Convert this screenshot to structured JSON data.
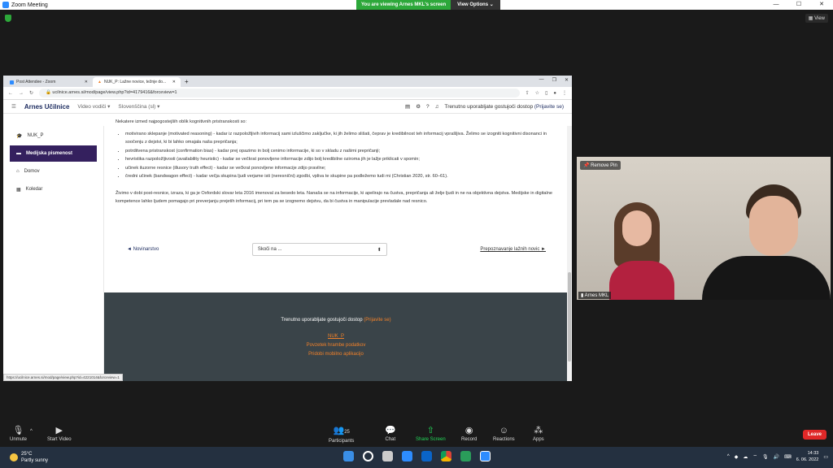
{
  "zoom": {
    "window_title": "Zoom Meeting",
    "banner": "You are viewing Arnes MKL's screen",
    "view_options": "View Options",
    "view_button": "View",
    "remove_pin": "Remove Pin",
    "participant_name": "Arnes MKL",
    "controls": {
      "unmute": "Unmute",
      "start_video": "Start Video",
      "participants": "Participants",
      "participants_count": "25",
      "chat": "Chat",
      "share_screen": "Share Screen",
      "record": "Record",
      "reactions": "Reactions",
      "apps": "Apps",
      "leave": "Leave"
    }
  },
  "browser": {
    "tabs": [
      {
        "label": "Post Attendee - Zoom"
      },
      {
        "label": "NUK_P: Lažne novice, težnje do..."
      }
    ],
    "url": "ucilnice.arnes.si/mod/page/view.php?id=4179416&forceview=1",
    "status_url": "https://ucilnice.arnes.si/mod/page/view.php?id=4221014&forceview=1"
  },
  "moodle": {
    "brand": "Arnes Učilnice",
    "video_menu": "Video vodiči",
    "language": "Slovenščina (sl)",
    "guest_notice": "Trenutno uporabljate gostujoči dostop",
    "login_link": "(Prijavite se)",
    "sidebar": [
      {
        "label": "NUK_P",
        "icon": "graduation-cap"
      },
      {
        "label": "Medijska pismenost",
        "icon": "folder"
      },
      {
        "label": "Domov",
        "icon": "home"
      },
      {
        "label": "Koledar",
        "icon": "calendar"
      }
    ],
    "content": {
      "intro": "Nekatere izmed najpogostejših oblik kognitivnih pristranskosti so:",
      "bullets": [
        "motivirano sklepanje (motivated reasoning) - kadar iz razpoložljivih informacij sami izluščimo zaključke, ki jih želimo slišati, čeprav je kredibilnost teh informacij vprašljiva. Želimo se izogniti kognitivni disonanci in soočenju z dejstvi, ki bi lahko omajala naša prepričanja;",
        "potrditvena pristranskost (confirmation bias) - kadar prej opazimo in bolj cenimo informacije, ki so v skladu z našimi prepričanji;",
        "hevristika razpoložljivosti (availability heuristic) - kadar se večkrat ponovljene informacije zdijo bolj kredibilne oziroma jih je lažje priklicati v spomin;",
        "učinek iluzorne resnice (illusory truth effect) - kadar se večkrat ponovljene informacije zdijo pravilne;",
        "čredni učinek (bandwagon effect) - kadar večja skupina ljudi verjame isti (neresnični) zgodbi, vpliva te skupine pa podležemo tudi mi (Christian 2020, str. 60–61)."
      ],
      "post_truth": "Živimo v dobi post-resnice, izraza, ki ga je Oxfordski slovar leta 2016 imenoval za besedo leta. Nanaša se na informacije, ki apelirajo na čustva, prepričanja ali želje ljudi in ne na objektivna dejstva. Medijske in digitalne kompetence lahko ljudem pomagajo pri preverjanju prejetih informacij, pri tem pa se izognemo dejstvu, da bi čustva in manipulacije prevladale nad resnico."
    },
    "pager": {
      "prev": "◄ Novinarstvo",
      "jump": "Skoči na ...",
      "next": "Prepoznavanje lažnih novic ►"
    },
    "footer": {
      "guest": "Trenutno uporabljate gostujoči dostop",
      "login": "(Prijavite se)",
      "links": [
        "NUK_P",
        "Povzetek hrambe podatkov",
        "Pridobi mobilno aplikacijo"
      ]
    }
  },
  "taskbar": {
    "temp": "25°C",
    "weather": "Partly sunny",
    "time": "14:33",
    "date": "6. 06. 2022"
  }
}
